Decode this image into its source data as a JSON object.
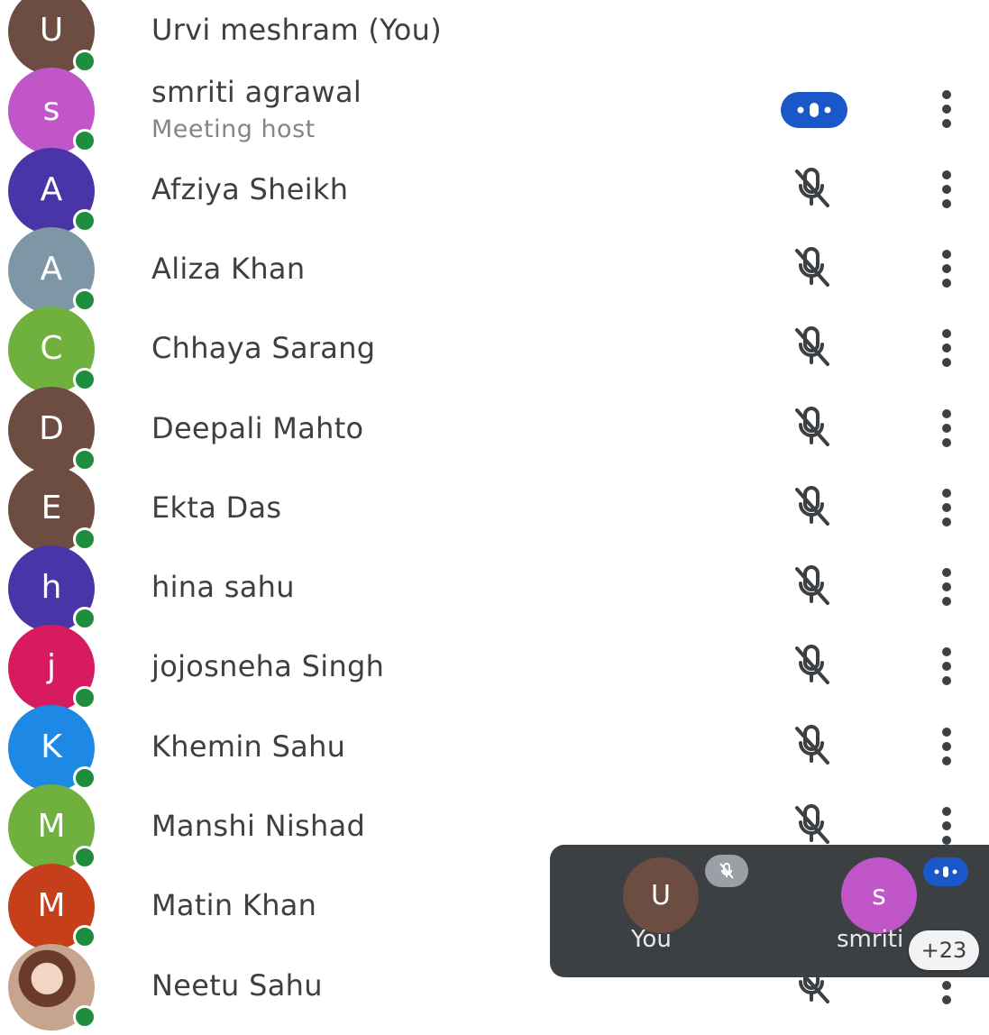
{
  "participants": [
    {
      "initial": "U",
      "name": "Urvi meshram (You)",
      "avatar_color": "#6d4c41",
      "status": "none"
    },
    {
      "initial": "s",
      "name": "smriti agrawal",
      "subtitle": "Meeting host",
      "avatar_color": "#c156c9",
      "status": "speaking"
    },
    {
      "initial": "A",
      "name": "Afziya Sheikh",
      "avatar_color": "#4a35a8",
      "status": "muted"
    },
    {
      "initial": "A",
      "name": "Aliza Khan",
      "avatar_color": "#7e96a6",
      "status": "muted"
    },
    {
      "initial": "C",
      "name": "Chhaya Sarang",
      "avatar_color": "#6fb03f",
      "status": "muted"
    },
    {
      "initial": "D",
      "name": "Deepali Mahto",
      "avatar_color": "#6d4c41",
      "status": "muted"
    },
    {
      "initial": "E",
      "name": "Ekta Das",
      "avatar_color": "#6d4c41",
      "status": "muted"
    },
    {
      "initial": "h",
      "name": "hina sahu",
      "avatar_color": "#4a35a8",
      "status": "muted"
    },
    {
      "initial": "j",
      "name": "jojosneha Singh",
      "avatar_color": "#d81b60",
      "status": "muted"
    },
    {
      "initial": "K",
      "name": "Khemin Sahu",
      "avatar_color": "#1e88e5",
      "status": "muted"
    },
    {
      "initial": "M",
      "name": "Manshi Nishad",
      "avatar_color": "#6fb03f",
      "status": "muted"
    },
    {
      "initial": "M",
      "name": "Matin Khan",
      "avatar_color": "#c53f1a",
      "status": "muted"
    },
    {
      "initial": "",
      "name": "Neetu Sahu",
      "avatar_color": "#b38f7a",
      "status": "muted",
      "photo": true
    }
  ],
  "floating_panel": {
    "tiles": [
      {
        "initial": "U",
        "label": "You",
        "avatar_color": "#6d4c41",
        "status": "muted"
      },
      {
        "initial": "s",
        "label": "smriti",
        "avatar_color": "#c156c9",
        "status": "speaking"
      }
    ],
    "overflow_count": "+23"
  },
  "icons": {
    "mic_off": "mic-off-icon",
    "more": "more-vert-icon",
    "speaking": "speaking-indicator-icon"
  }
}
